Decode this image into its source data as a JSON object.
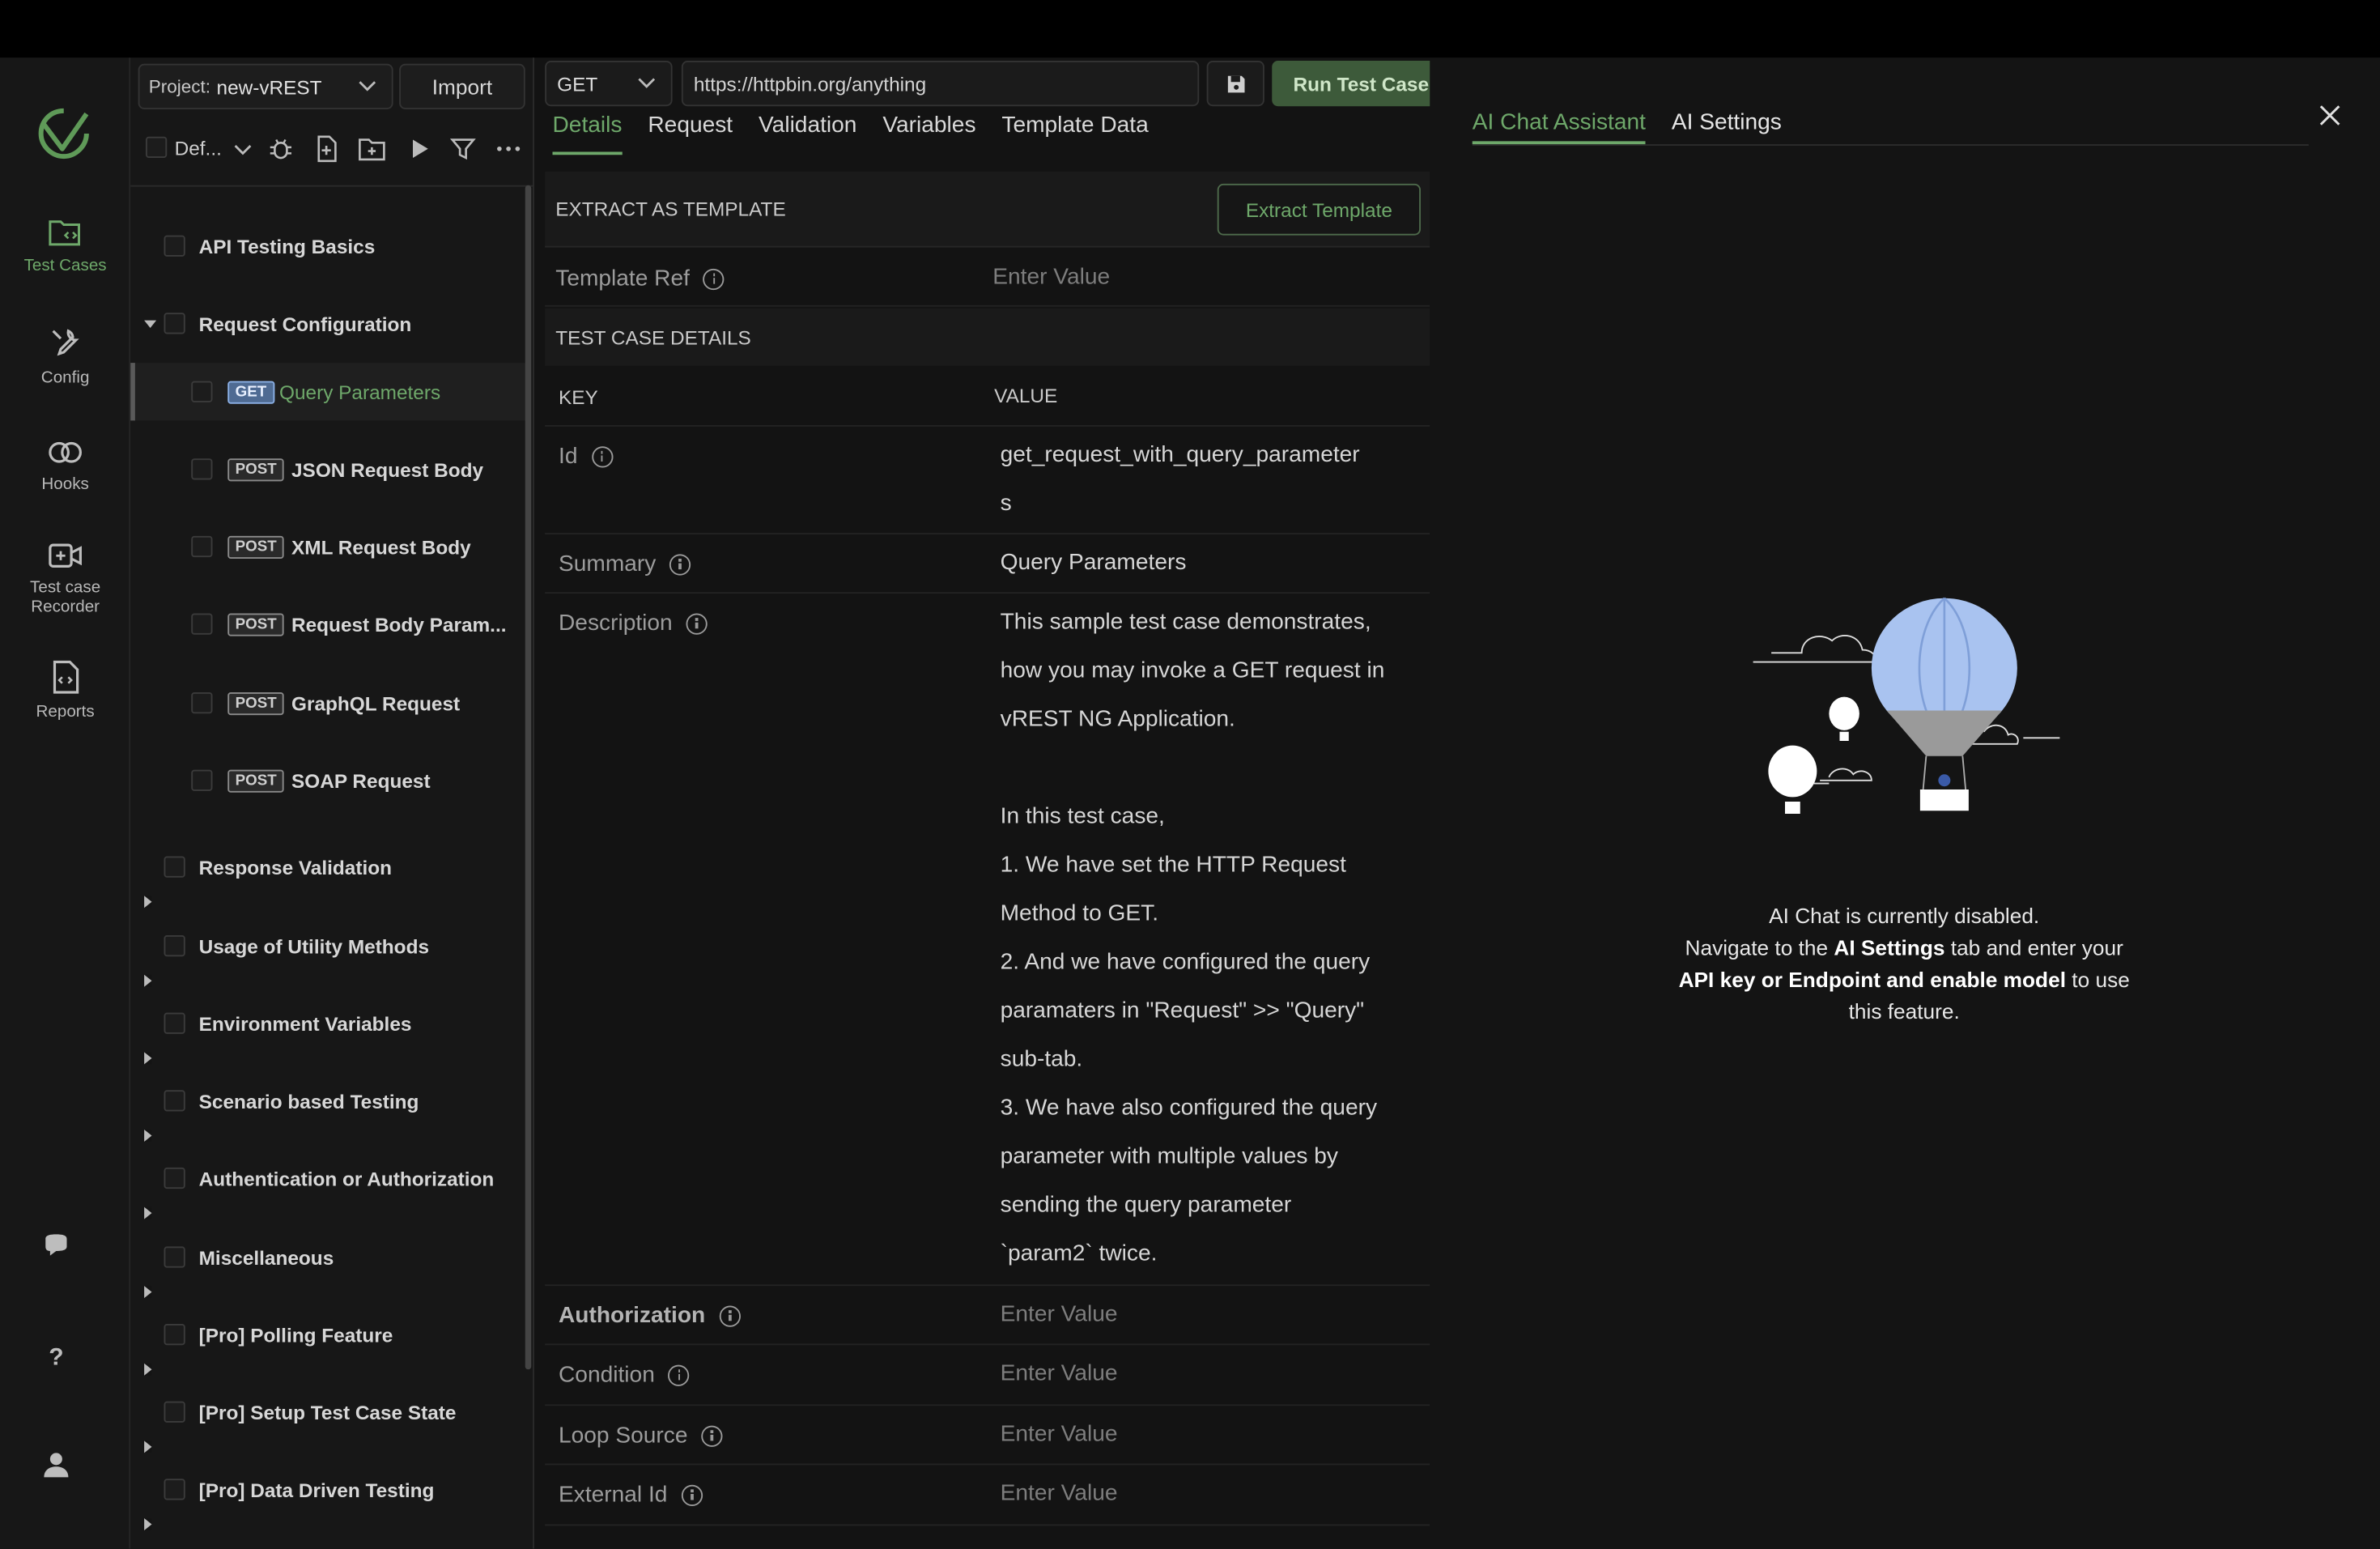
{
  "nav": {
    "items": [
      {
        "label": "Test Cases",
        "icon": "folder-code-icon"
      },
      {
        "label": "Config",
        "icon": "wrench-icon"
      },
      {
        "label": "Hooks",
        "icon": "hooks-icon"
      },
      {
        "label_line1": "Test case",
        "label_line2": "Recorder",
        "icon": "recorder-icon"
      },
      {
        "label": "Reports",
        "icon": "report-icon"
      }
    ]
  },
  "tree": {
    "project_label": "Project:",
    "project_value": "new-vREST",
    "import_label": "Import",
    "filter_label": "Def...",
    "items": [
      {
        "label": "API Testing Basics"
      },
      {
        "label": "Request Configuration"
      },
      {
        "method": "GET",
        "label": "Query Parameters"
      },
      {
        "method": "POST",
        "label": "JSON Request Body"
      },
      {
        "method": "POST",
        "label": "XML Request Body"
      },
      {
        "method": "POST",
        "label": "Request Body Param..."
      },
      {
        "method": "POST",
        "label": "GraphQL Request"
      },
      {
        "method": "POST",
        "label": "SOAP Request"
      },
      {
        "label": "Response Validation"
      },
      {
        "label": "Usage of Utility Methods"
      },
      {
        "label": "Environment Variables"
      },
      {
        "label": "Scenario based Testing"
      },
      {
        "label": "Authentication or Authorization"
      },
      {
        "label": "Miscellaneous"
      },
      {
        "label": "[Pro] Polling Feature"
      },
      {
        "label": "[Pro] Setup Test Case State"
      },
      {
        "label": "[Pro] Data Driven Testing"
      }
    ]
  },
  "request": {
    "method": "GET",
    "url": "https://httpbin.org/anything",
    "run_label": "Run Test Case"
  },
  "tabs": [
    "Details",
    "Request",
    "Validation",
    "Variables",
    "Template Data"
  ],
  "details": {
    "extract_header": "EXTRACT AS TEMPLATE",
    "extract_button": "Extract Template",
    "template_ref_label": "Template Ref",
    "placeholder": "Enter Value",
    "section_header": "TEST CASE DETAILS",
    "col_key": "KEY",
    "col_value": "VALUE",
    "id_label": "Id",
    "id_value_line1": "get_request_with_query_parameter",
    "id_value_line2": "s",
    "summary_label": "Summary",
    "summary_value": "Query Parameters",
    "description_label": "Description",
    "description_value": "This sample test case demonstrates,\nhow you may invoke a GET request in\nvREST NG Application.\n\nIn this test case,\n1. We have set the HTTP Request\nMethod to GET.\n2. And we have configured the query\nparamaters in \"Request\" >> \"Query\"\nsub-tab.\n3. We have also configured the query\nparameter with multiple values by\nsending the query parameter\n`param2` twice.",
    "authorization_label": "Authorization",
    "condition_label": "Condition",
    "loop_source_label": "Loop Source",
    "external_id_label": "External Id"
  },
  "ai": {
    "tab_chat": "AI Chat Assistant",
    "tab_settings": "AI Settings",
    "msg_line1": "AI Chat is currently disabled.",
    "msg_prefix": "Navigate to the ",
    "msg_settings": "AI Settings",
    "msg_mid": " tab and enter your",
    "msg_key": "API key or Endpoint and enable model",
    "msg_suffix": " to use",
    "msg_end": "this feature."
  },
  "colors": {
    "accent": "#6ea86a",
    "balloon": "#a9c3f0",
    "get_badge": "#4f6b93"
  }
}
